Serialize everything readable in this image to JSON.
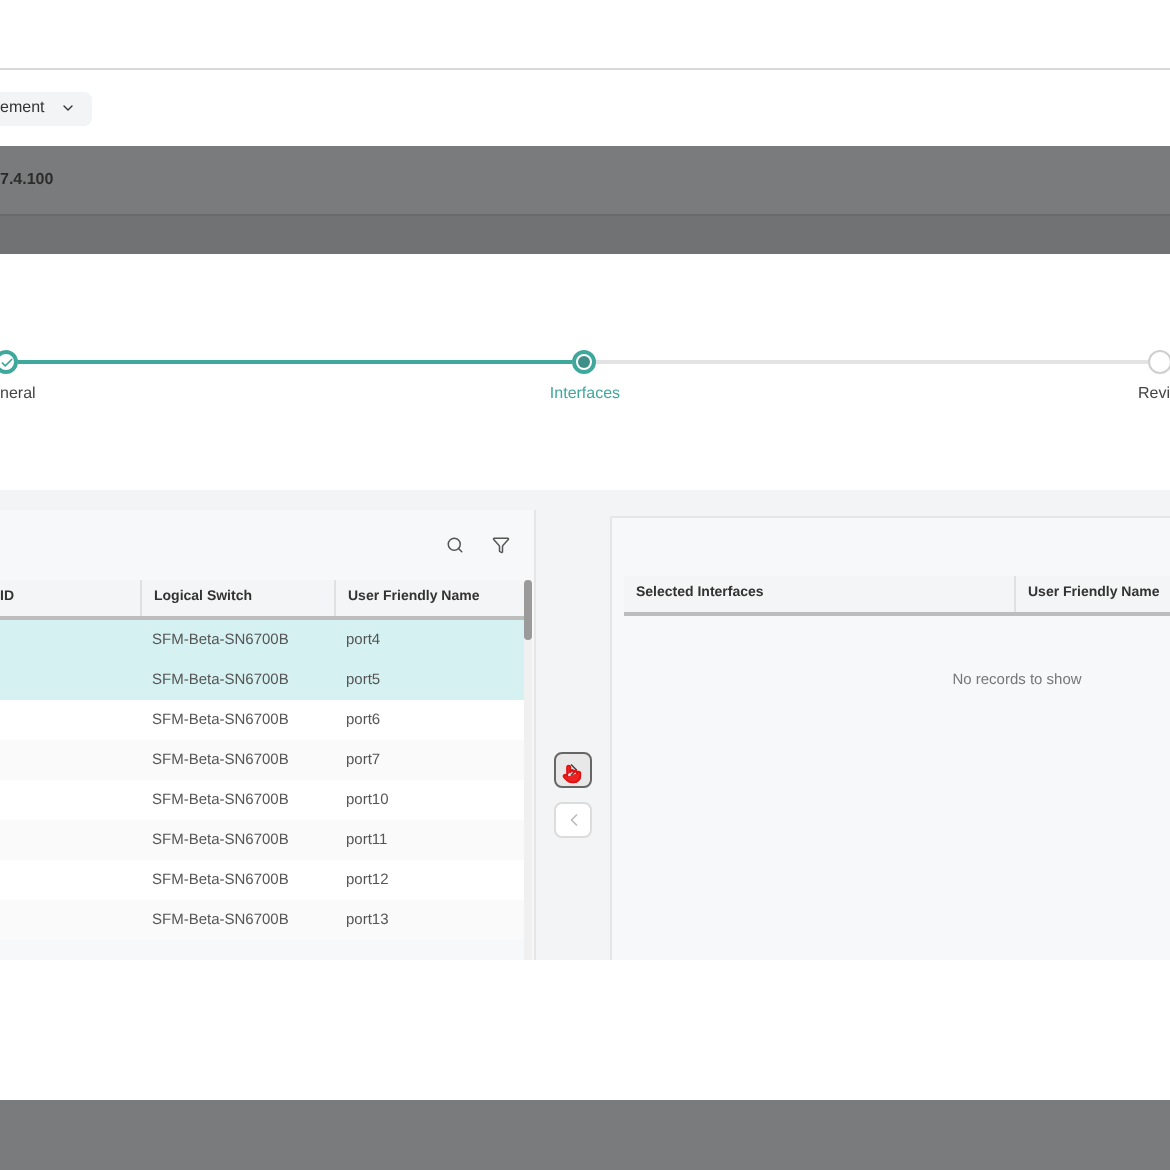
{
  "menu": {
    "label": "ement"
  },
  "banner": {
    "title": "7.4.100"
  },
  "steps": [
    {
      "label": "neral",
      "kind": "done"
    },
    {
      "label": "Interfaces",
      "kind": "current"
    },
    {
      "label": "Revi",
      "kind": "todo"
    }
  ],
  "available": {
    "columns": [
      "ID",
      "Logical Switch",
      "User Friendly Name"
    ],
    "rows": [
      {
        "selected": true,
        "logical_switch": "SFM-Beta-SN6700B",
        "user_friendly_name": "port4"
      },
      {
        "selected": true,
        "logical_switch": "SFM-Beta-SN6700B",
        "user_friendly_name": "port5"
      },
      {
        "selected": false,
        "logical_switch": "SFM-Beta-SN6700B",
        "user_friendly_name": "port6"
      },
      {
        "selected": false,
        "logical_switch": "SFM-Beta-SN6700B",
        "user_friendly_name": "port7"
      },
      {
        "selected": false,
        "logical_switch": "SFM-Beta-SN6700B",
        "user_friendly_name": "port10"
      },
      {
        "selected": false,
        "logical_switch": "SFM-Beta-SN6700B",
        "user_friendly_name": "port11"
      },
      {
        "selected": false,
        "logical_switch": "SFM-Beta-SN6700B",
        "user_friendly_name": "port12"
      },
      {
        "selected": false,
        "logical_switch": "SFM-Beta-SN6700B",
        "user_friendly_name": "port13"
      }
    ]
  },
  "transfer": [
    {
      "kind": "add",
      "disabled": false
    },
    {
      "kind": "remove",
      "disabled": true
    }
  ],
  "selected": {
    "columns": [
      "Selected Interfaces",
      "User Friendly Name"
    ],
    "empty_message": "No records to show"
  }
}
